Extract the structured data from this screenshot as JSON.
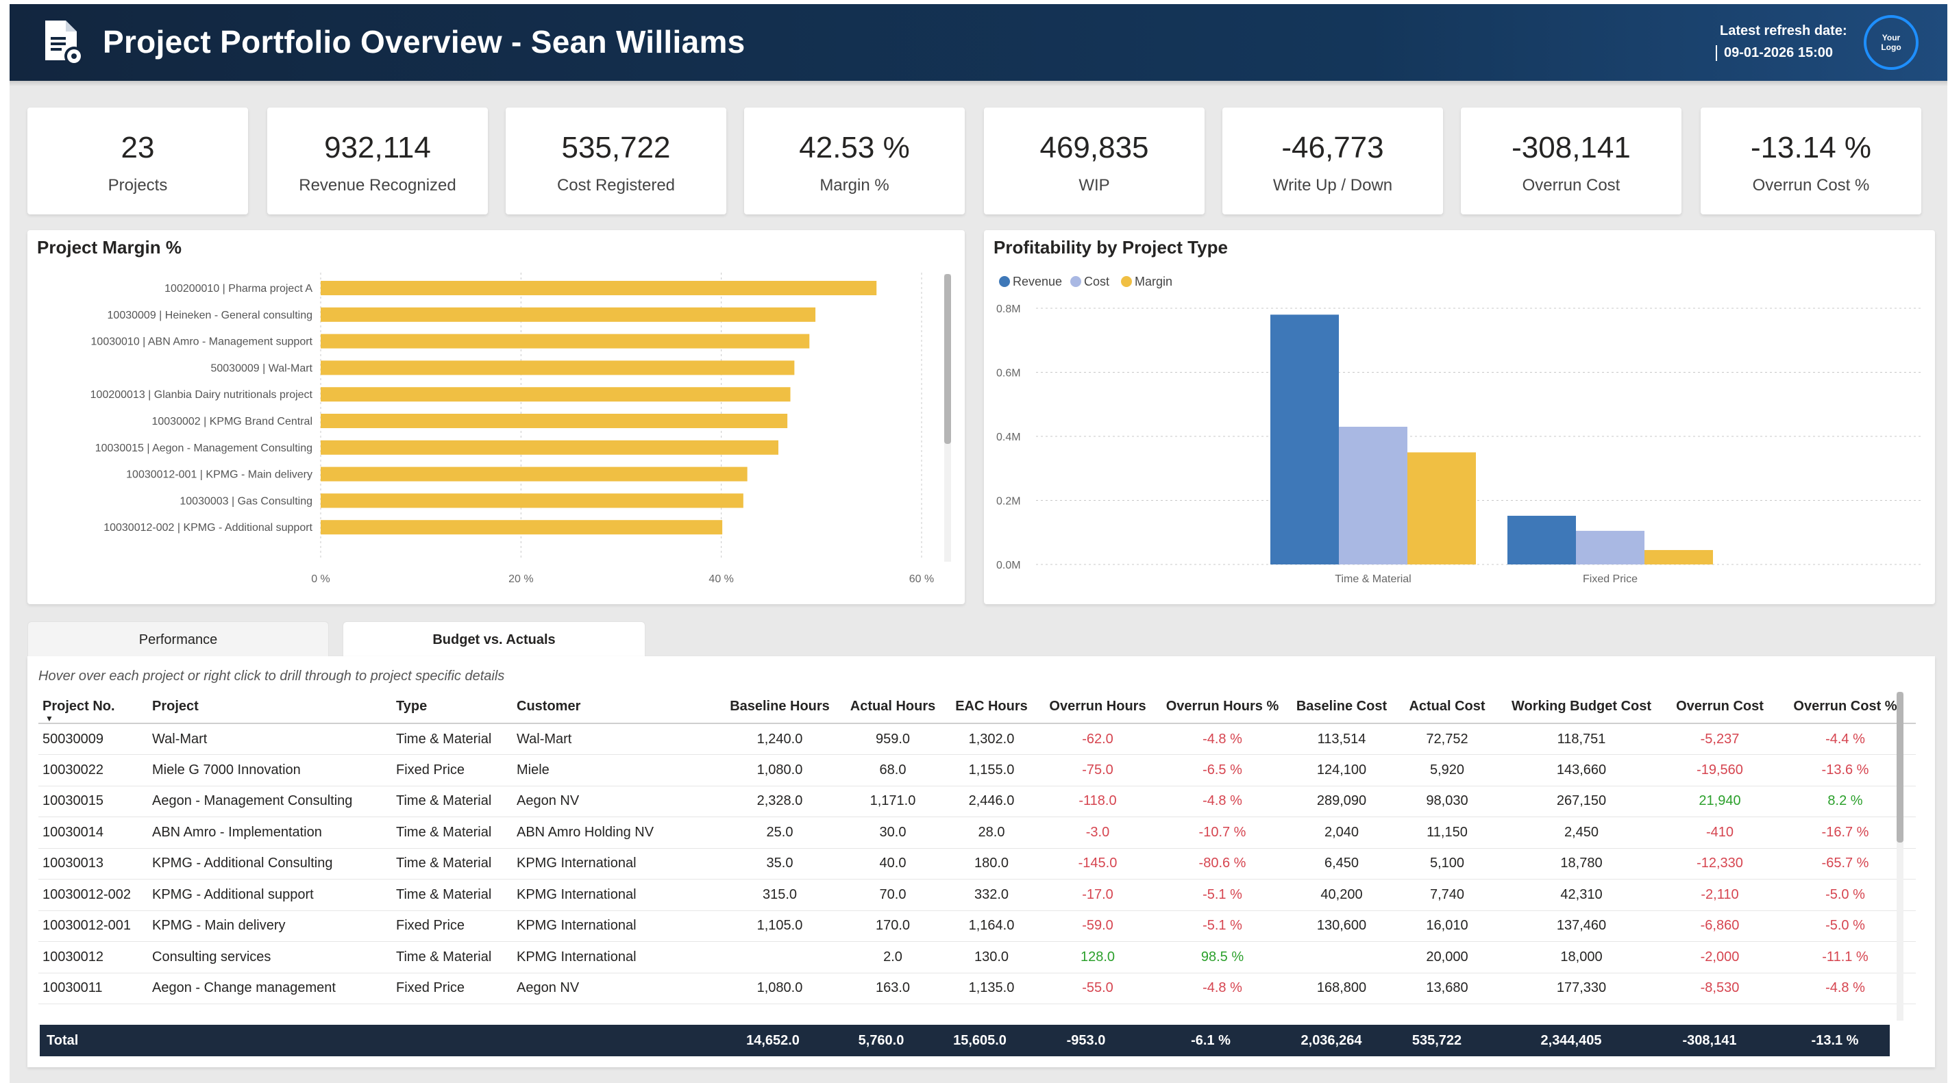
{
  "header": {
    "title": "Project Portfolio Overview - Sean Williams",
    "refresh_label": "Latest refresh date:",
    "refresh_value": "09-01-2026 15:00",
    "logo_text": "Your Logo"
  },
  "kpis": [
    {
      "value": "23",
      "label": "Projects"
    },
    {
      "value": "932,114",
      "label": "Revenue Recognized"
    },
    {
      "value": "535,722",
      "label": "Cost Registered"
    },
    {
      "value": "42.53 %",
      "label": "Margin %"
    },
    {
      "value": "469,835",
      "label": "WIP"
    },
    {
      "value": "-46,773",
      "label": "Write Up / Down"
    },
    {
      "value": "-308,141",
      "label": "Overrun Cost"
    },
    {
      "value": "-13.14 %",
      "label": "Overrun Cost %"
    }
  ],
  "margin_panel": {
    "title": "Project Margin %"
  },
  "profit_panel": {
    "title": "Profitability by Project Type"
  },
  "chart_data": [
    {
      "type": "bar",
      "orientation": "horizontal",
      "title": "Project Margin %",
      "categories": [
        "100200010 | Pharma project A",
        "10030009 | Heineken - General consulting",
        "10030010 | ABN Amro - Management support",
        "50030009 | Wal-Mart",
        "100200013 | Glanbia Dairy nutritionals project",
        "10030002 | KPMG Brand Central",
        "10030015 | Aegon - Management Consulting",
        "10030012-001 | KPMG - Main delivery",
        "10030003 | Gas Consulting",
        "10030012-002 | KPMG - Additional support"
      ],
      "values": [
        55.5,
        49.4,
        48.8,
        47.3,
        46.9,
        46.6,
        45.7,
        42.6,
        42.2,
        40.1
      ],
      "xlim": [
        0,
        60
      ],
      "xticks": [
        "0 %",
        "20 %",
        "40 %",
        "60 %"
      ],
      "xtick_values": [
        0,
        20,
        40,
        60
      ],
      "color": "#f0bf43",
      "grid": true
    },
    {
      "type": "bar",
      "title": "Profitability by Project Type",
      "categories": [
        "Time & Material",
        "Fixed Price"
      ],
      "series": [
        {
          "name": "Revenue",
          "values": [
            780000,
            152000
          ],
          "color": "#3e78b8"
        },
        {
          "name": "Cost",
          "values": [
            430000,
            105000
          ],
          "color": "#a9b8e3"
        },
        {
          "name": "Margin",
          "values": [
            350000,
            45000
          ],
          "color": "#f0bf43"
        }
      ],
      "ylim": [
        0,
        800000
      ],
      "yticks": [
        "0.0M",
        "0.2M",
        "0.4M",
        "0.6M",
        "0.8M"
      ],
      "ytick_values": [
        0,
        200000,
        400000,
        600000,
        800000
      ],
      "legend": "top-left",
      "grid": true
    }
  ],
  "tabs": [
    {
      "label": "Performance",
      "active": false
    },
    {
      "label": "Budget vs. Actuals",
      "active": true
    }
  ],
  "table": {
    "hint": "Hover over each project or right click to drill through to project specific details",
    "columns": [
      "Project No.",
      "Project",
      "Type",
      "Customer",
      "Baseline Hours",
      "Actual Hours",
      "EAC Hours",
      "Overrun Hours",
      "Overrun Hours %",
      "Baseline Cost",
      "Actual Cost",
      "Working Budget Cost",
      "Overrun Cost",
      "Overrun Cost %"
    ],
    "rows": [
      [
        "50030009",
        "Wal-Mart",
        "Time & Material",
        "Wal-Mart",
        "1,240.0",
        "959.0",
        "1,302.0",
        "-62.0",
        "-4.8 %",
        "113,514",
        "72,752",
        "118,751",
        "-5,237",
        "-4.4 %"
      ],
      [
        "10030022",
        "Miele G 7000 Innovation",
        "Fixed Price",
        "Miele",
        "1,080.0",
        "68.0",
        "1,155.0",
        "-75.0",
        "-6.5 %",
        "124,100",
        "5,920",
        "143,660",
        "-19,560",
        "-13.6 %"
      ],
      [
        "10030015",
        "Aegon - Management Consulting",
        "Time & Material",
        "Aegon NV",
        "2,328.0",
        "1,171.0",
        "2,446.0",
        "-118.0",
        "-4.8 %",
        "289,090",
        "98,030",
        "267,150",
        "21,940",
        "8.2 %"
      ],
      [
        "10030014",
        "ABN Amro - Implementation",
        "Time & Material",
        "ABN Amro Holding NV",
        "25.0",
        "30.0",
        "28.0",
        "-3.0",
        "-10.7 %",
        "2,040",
        "11,150",
        "2,450",
        "-410",
        "-16.7 %"
      ],
      [
        "10030013",
        "KPMG - Additional Consulting",
        "Time & Material",
        "KPMG International",
        "35.0",
        "40.0",
        "180.0",
        "-145.0",
        "-80.6 %",
        "6,450",
        "5,100",
        "18,780",
        "-12,330",
        "-65.7 %"
      ],
      [
        "10030012-002",
        "KPMG - Additional support",
        "Time & Material",
        "KPMG International",
        "315.0",
        "70.0",
        "332.0",
        "-17.0",
        "-5.1 %",
        "40,200",
        "7,740",
        "42,310",
        "-2,110",
        "-5.0 %"
      ],
      [
        "10030012-001",
        "KPMG - Main delivery",
        "Fixed Price",
        "KPMG International",
        "1,105.0",
        "170.0",
        "1,164.0",
        "-59.0",
        "-5.1 %",
        "130,600",
        "16,010",
        "137,460",
        "-6,860",
        "-5.0 %"
      ],
      [
        "10030012",
        "Consulting services",
        "Time & Material",
        "KPMG International",
        "",
        "2.0",
        "130.0",
        "128.0",
        "98.5 %",
        "",
        "20,000",
        "18,000",
        "-2,000",
        "-11.1 %"
      ],
      [
        "10030011",
        "Aegon - Change management",
        "Fixed Price",
        "Aegon NV",
        "1,080.0",
        "163.0",
        "1,135.0",
        "-55.0",
        "-4.8 %",
        "168,800",
        "13,680",
        "177,330",
        "-8,530",
        "-4.8 %"
      ]
    ],
    "total": {
      "label": "Total",
      "values": [
        "14,652.0",
        "5,760.0",
        "15,605.0",
        "-953.0",
        "-6.1 %",
        "2,036,264",
        "535,722",
        "2,344,405",
        "-308,141",
        "-13.1 %"
      ]
    }
  }
}
